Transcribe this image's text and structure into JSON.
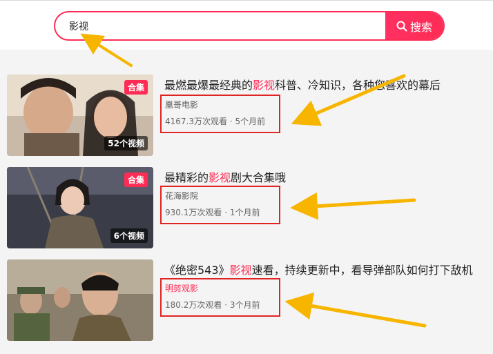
{
  "search": {
    "query": "影视",
    "button_label": "搜索"
  },
  "items": [
    {
      "badge": "合集",
      "count": "52个视频",
      "title_pre": "最燃最爆最经典的",
      "title_hl": "影视",
      "title_post": "科普、冷知识，各种您喜欢的幕后",
      "author": "凰哥电影",
      "views": "4167.3万次观看",
      "sep": "·",
      "time": "5个月前"
    },
    {
      "badge": "合集",
      "count": "6个视频",
      "title_pre": "最精彩的",
      "title_hl": "影视",
      "title_post": "剧大合集哦",
      "author": "花海影院",
      "views": "930.1万次观看",
      "sep": "·",
      "time": "1个月前"
    },
    {
      "title_pre": "《绝密543》",
      "title_hl": "影视",
      "title_post": "速看，持续更新中，看导弹部队如何打下敌机",
      "author": "明剪观影",
      "views": "180.2万次观看",
      "sep": "·",
      "time": "3个月前"
    }
  ],
  "colors": {
    "accent": "#fe2c55",
    "annotation": "#e02424",
    "arrow": "#f7b500"
  }
}
